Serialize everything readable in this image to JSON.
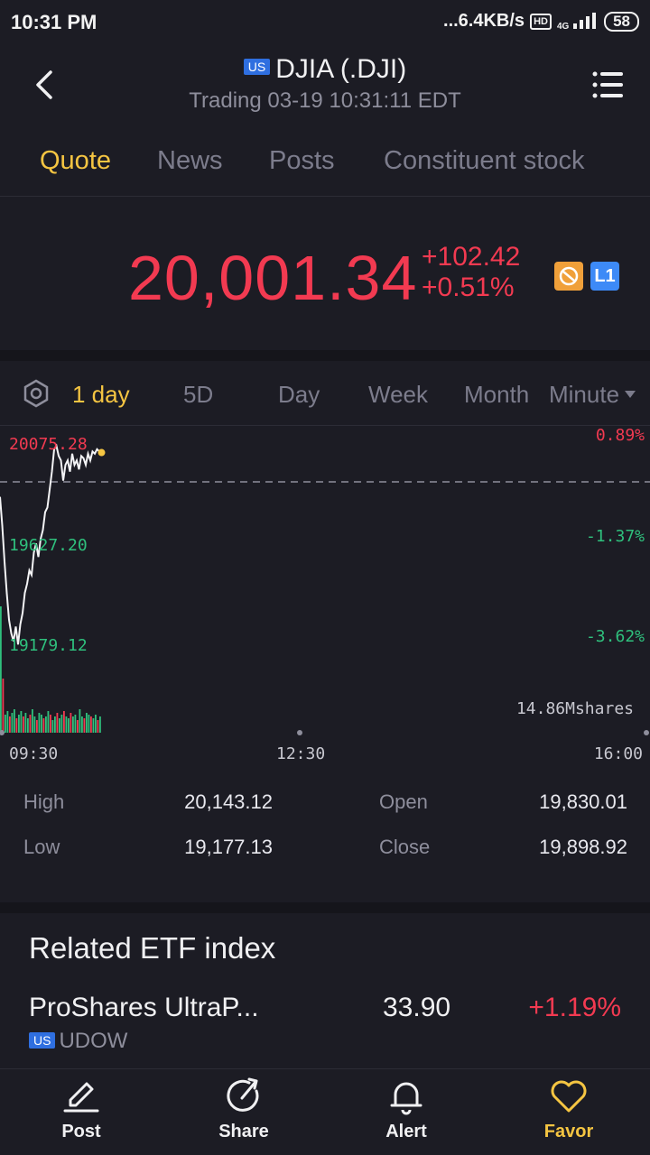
{
  "status_bar": {
    "time": "10:31 PM",
    "network": "...6.4KB/s",
    "hd": "HD",
    "signal_type": "4G",
    "battery": "58"
  },
  "header": {
    "market_badge": "US",
    "title": "DJIA (.DJI)",
    "subtitle": "Trading 03-19 10:31:11 EDT"
  },
  "tabs": [
    "Quote",
    "News",
    "Posts",
    "Constituent stock"
  ],
  "active_tab": "Quote",
  "quote": {
    "price": "20,001.34",
    "change": "+102.42",
    "change_pct": "+0.51%",
    "level_badge": "L1"
  },
  "range_tabs": {
    "items": [
      "1 day",
      "5D",
      "Day",
      "Week",
      "Month"
    ],
    "minute_label": "Minute",
    "active": "1 day"
  },
  "chart_data": {
    "type": "line",
    "x_labels": [
      "09:30",
      "12:30",
      "16:00"
    ],
    "y_labels_left": [
      "20075.28",
      "19627.20",
      "19179.12"
    ],
    "y_labels_right": [
      "0.89%",
      "-1.37%",
      "-3.62%"
    ],
    "volume_label": "14.86Mshares",
    "prev_close": 19898.92,
    "ylim": [
      19179.12,
      20075.28
    ],
    "series": [
      {
        "x": [
          0,
          1,
          2,
          3,
          4,
          5,
          6,
          7,
          8,
          9,
          10,
          11,
          12,
          13,
          14,
          15,
          16,
          17,
          18,
          19,
          20,
          21,
          22,
          23,
          24,
          25,
          26,
          27,
          28,
          29,
          30,
          31,
          32,
          33,
          34,
          35,
          36,
          37,
          38,
          39,
          40,
          41,
          42,
          43,
          44,
          45
        ],
        "values": [
          19848,
          19720,
          19560,
          19420,
          19300,
          19240,
          19205,
          19270,
          19190,
          19280,
          19330,
          19420,
          19460,
          19520,
          19500,
          19600,
          19640,
          19580,
          19660,
          19700,
          19780,
          19800,
          19880,
          19960,
          20060,
          20075,
          20030,
          20010,
          19920,
          19990,
          20010,
          19960,
          20040,
          19990,
          20010,
          19970,
          20030,
          20020,
          19990,
          20040,
          20010,
          20050,
          20040,
          20060,
          20050,
          20045
        ]
      }
    ],
    "volume_up_color": "#2fc07d",
    "volume_down_color": "#f23a51"
  },
  "stats": {
    "high_label": "High",
    "high": "20,143.12",
    "low_label": "Low",
    "low": "19,177.13",
    "open_label": "Open",
    "open": "19,830.01",
    "close_label": "Close",
    "close": "19,898.92"
  },
  "etf": {
    "section_title": "Related ETF index",
    "name": "ProShares UltraP...",
    "market_badge": "US",
    "code": "UDOW",
    "price": "33.90",
    "change_pct": "+1.19%"
  },
  "bottom_nav": {
    "post": "Post",
    "share": "Share",
    "alert": "Alert",
    "favor": "Favor"
  },
  "colors": {
    "up": "#f23a51",
    "down": "#2fc07d",
    "accent": "#f5c542",
    "background": "#1c1c24"
  }
}
